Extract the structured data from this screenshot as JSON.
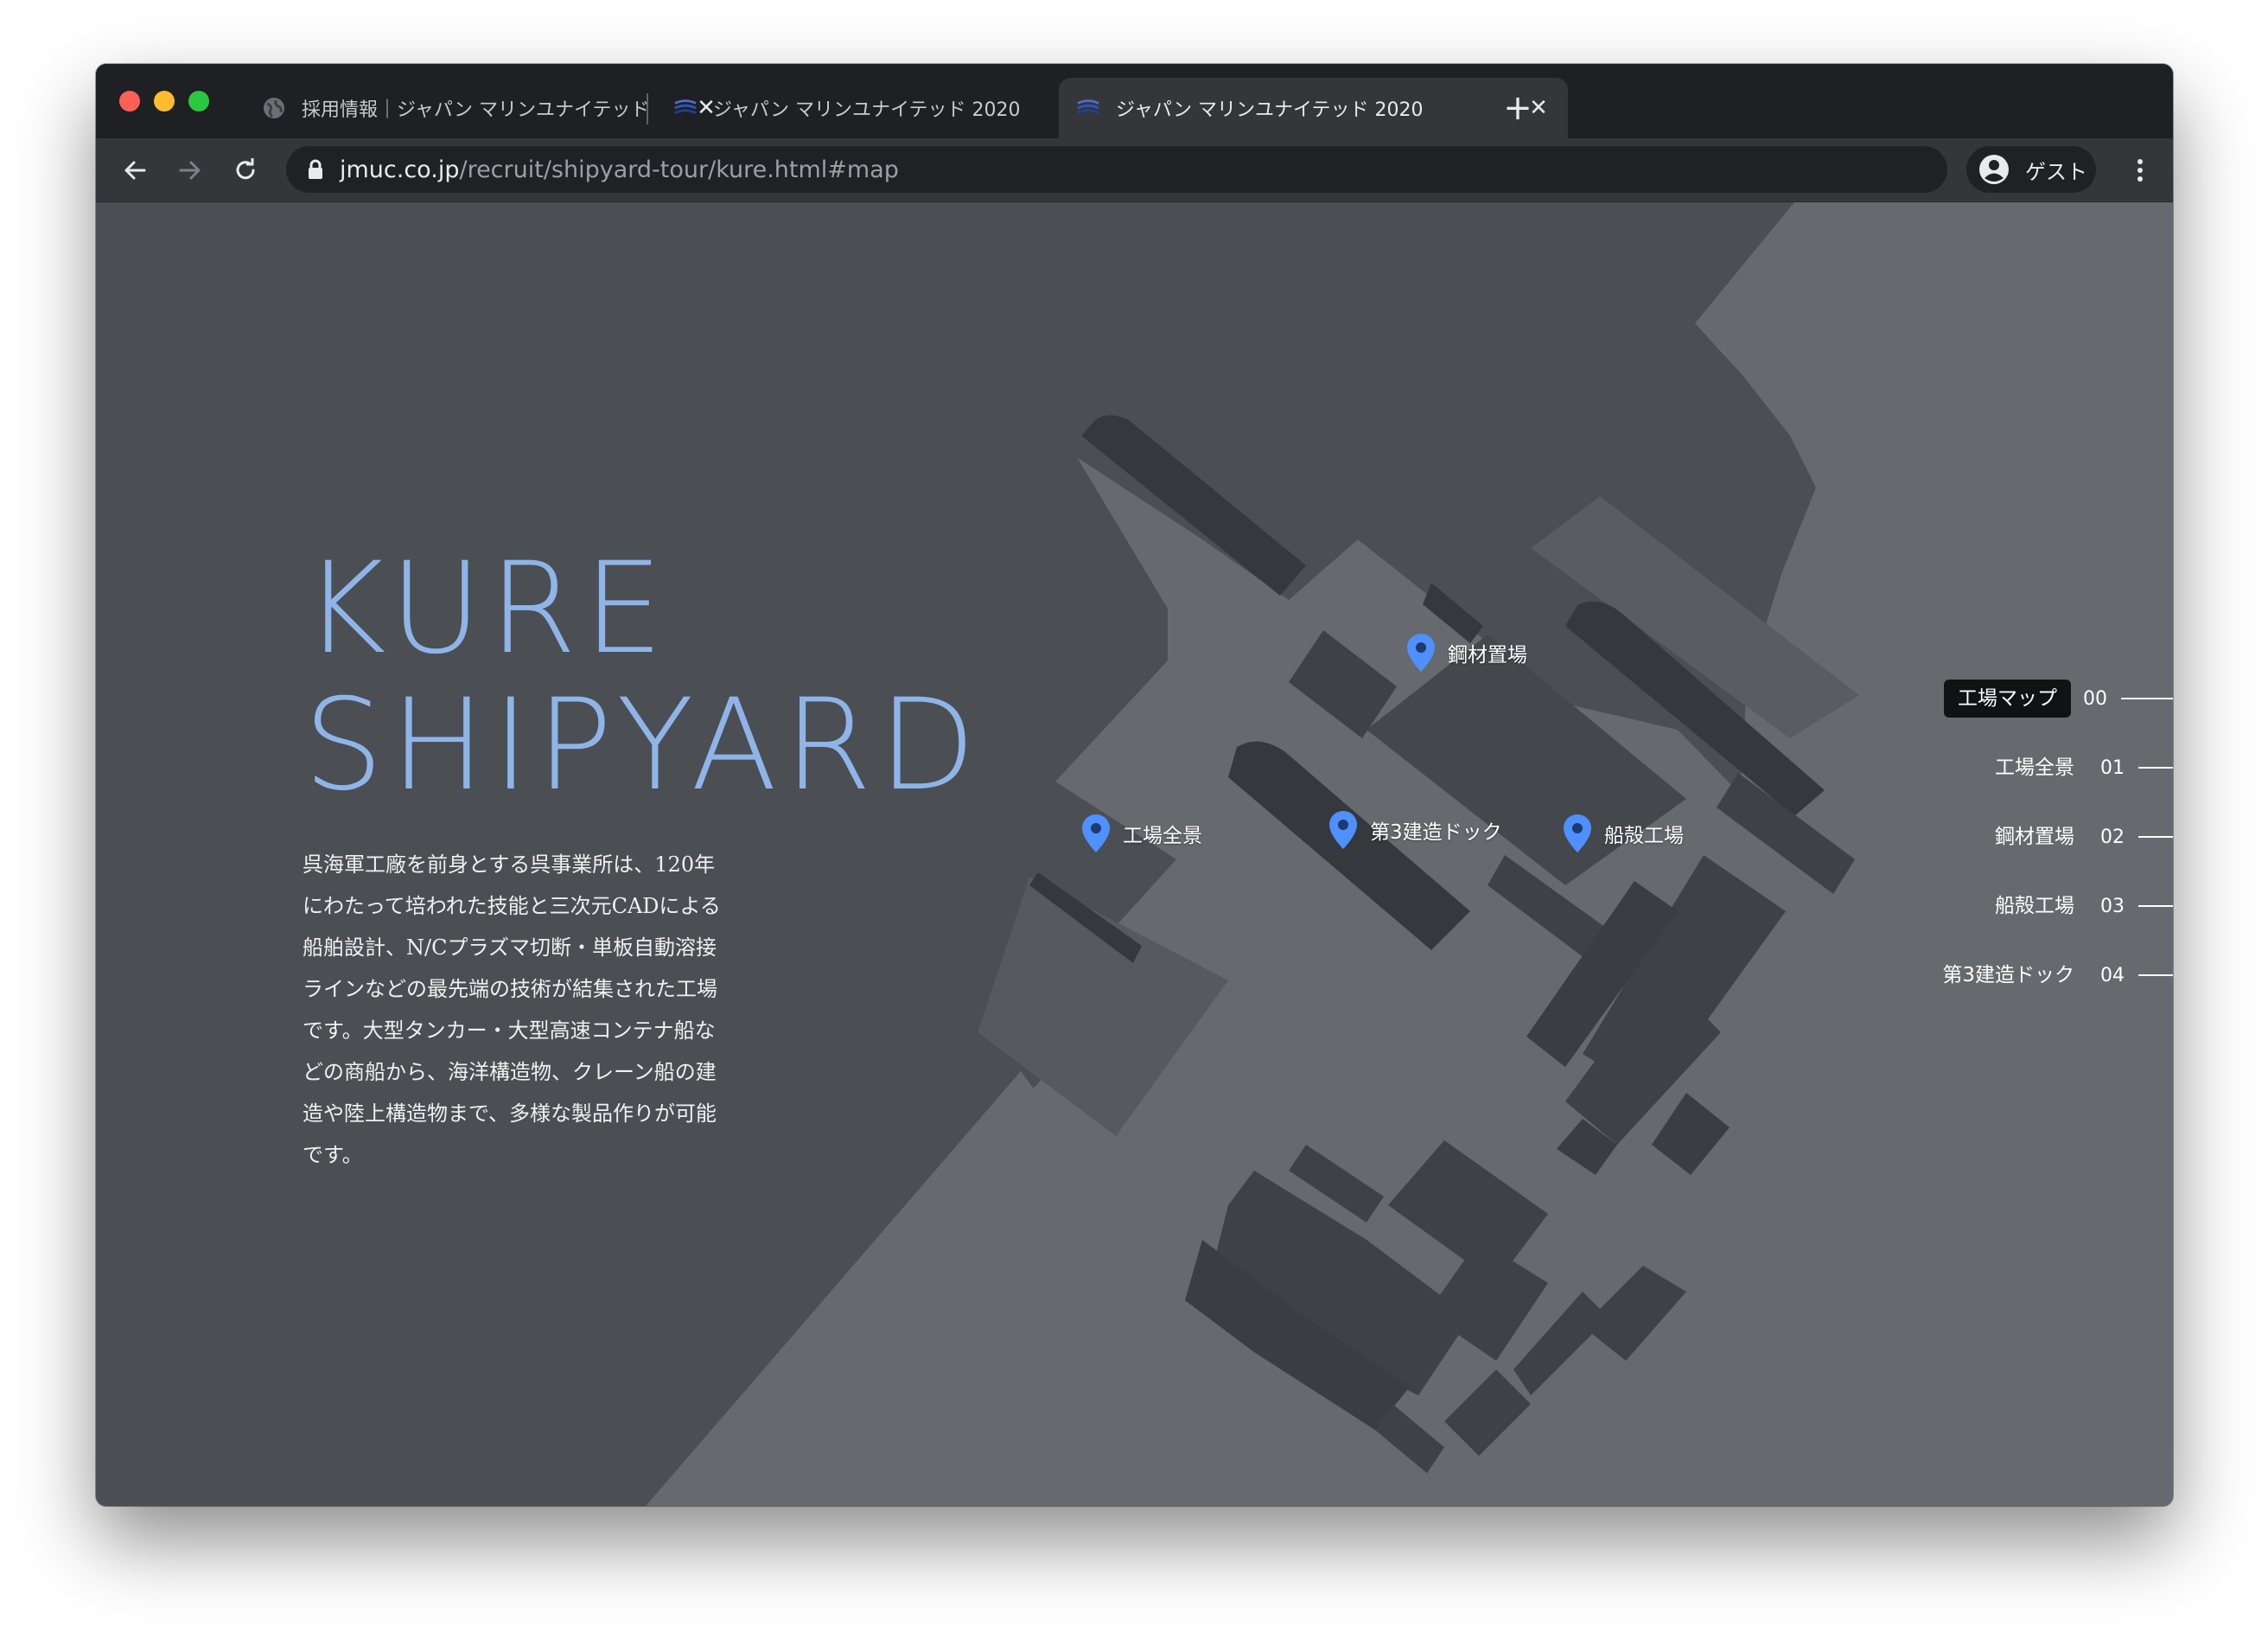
{
  "browser": {
    "tabs": [
      {
        "title": "採用情報｜ジャパン マリンユナイテッド",
        "active": false
      },
      {
        "title": "ジャパン マリンユナイテッド 2020",
        "active": false
      },
      {
        "title": "ジャパン マリンユナイテッド 2020",
        "active": true
      }
    ],
    "new_tab": "+",
    "close_glyph": "✕",
    "url_host": "jmuc.co.jp",
    "url_path": "/recruit/shipyard-tour/kure.html#map",
    "profile_name": "ゲスト"
  },
  "page": {
    "hero_line1": "KURE",
    "hero_line2": "SHIPYARD",
    "description": "呉海軍工廠を前身とする呉事業所は、120年にわたって培われた技能と三次元CADによる船舶設計、N/Cプラズマ切断・単板自動溶接ラインなどの最先端の技術が結集された工場です。大型タンカー・大型高速コンテナ船などの商船から、海洋構造物、クレーン船の建造や陸上構造物まで、多様な製品作りが可能です。",
    "pins": [
      {
        "label": "鋼材置場"
      },
      {
        "label": "工場全景"
      },
      {
        "label": "第3建造ドック"
      },
      {
        "label": "船殻工場"
      }
    ],
    "nav": [
      {
        "label": "工場マップ",
        "num": "00",
        "active": true
      },
      {
        "label": "工場全景",
        "num": "01",
        "active": false
      },
      {
        "label": "鋼材置場",
        "num": "02",
        "active": false
      },
      {
        "label": "船殻工場",
        "num": "03",
        "active": false
      },
      {
        "label": "第3建造ドック",
        "num": "04",
        "active": false
      }
    ]
  },
  "colors": {
    "hero": "#8fb4e8",
    "pin": "#4d90fe",
    "water": "#4b4e53",
    "land": "#66696d",
    "building": "#3e4146",
    "ship": "#33363a"
  }
}
